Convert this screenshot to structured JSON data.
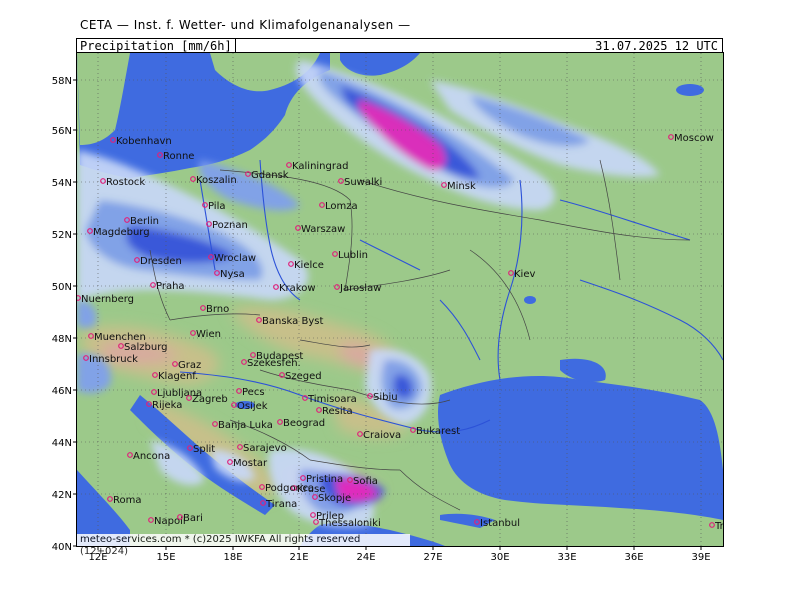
{
  "header": {
    "title": "CETA — Inst. f. Wetter- und Klimafolgenanalysen —",
    "parameter": "Precipitation [mm/6h]",
    "valid_time": "31.07.2025 12 UTC"
  },
  "footer": {
    "copyright": "meteo-services.com * (c)2025 IWKFA  All rights reserved (12+024)"
  },
  "axes": {
    "lat_labels": [
      "58N",
      "56N",
      "54N",
      "52N",
      "50N",
      "48N",
      "46N",
      "44N",
      "42N",
      "40N"
    ],
    "lon_labels": [
      "12E",
      "15E",
      "18E",
      "21E",
      "24E",
      "27E",
      "30E",
      "33E",
      "36E",
      "39E"
    ]
  },
  "colors": {
    "land": "#9cc98a",
    "land_high": "#c7c08a",
    "mountain": "#d9a8a0",
    "sea": "#3f6be0",
    "precip_light": "#c8d8f8",
    "precip_mid": "#7f9fef",
    "precip_heavy": "#3050e0",
    "precip_extreme": "#e020c0",
    "city_marker": "#e0207a"
  },
  "cities": [
    {
      "name": "Kobenhavn"
    },
    {
      "name": "Ronne"
    },
    {
      "name": "Rostock"
    },
    {
      "name": "Koszalin"
    },
    {
      "name": "Gdansk"
    },
    {
      "name": "Kaliningrad"
    },
    {
      "name": "Suwalki"
    },
    {
      "name": "Minsk"
    },
    {
      "name": "Moscow"
    },
    {
      "name": "Pila"
    },
    {
      "name": "Lomza"
    },
    {
      "name": "Berlin"
    },
    {
      "name": "Magdeburg"
    },
    {
      "name": "Poznan"
    },
    {
      "name": "Warszaw"
    },
    {
      "name": "Lublin"
    },
    {
      "name": "Dresden"
    },
    {
      "name": "Wroclaw"
    },
    {
      "name": "Kielce"
    },
    {
      "name": "Nysa"
    },
    {
      "name": "Praha"
    },
    {
      "name": "Krakow"
    },
    {
      "name": "Jaroslaw"
    },
    {
      "name": "Kiev"
    },
    {
      "name": "Nuernberg"
    },
    {
      "name": "Brno"
    },
    {
      "name": "Banska Byst"
    },
    {
      "name": "Muenchen"
    },
    {
      "name": "Salzburg"
    },
    {
      "name": "Wien"
    },
    {
      "name": "Budapest"
    },
    {
      "name": "Szekesfeh."
    },
    {
      "name": "Innsbruck"
    },
    {
      "name": "Graz"
    },
    {
      "name": "Klagenf."
    },
    {
      "name": "Szeged"
    },
    {
      "name": "Ljubljana"
    },
    {
      "name": "Pecs"
    },
    {
      "name": "Zagreb"
    },
    {
      "name": "Rijeka"
    },
    {
      "name": "Osijek"
    },
    {
      "name": "Timisoara"
    },
    {
      "name": "Sibiu"
    },
    {
      "name": "Resita"
    },
    {
      "name": "Banja Luka"
    },
    {
      "name": "Beograd"
    },
    {
      "name": "Bukarest"
    },
    {
      "name": "Craiova"
    },
    {
      "name": "Ancona"
    },
    {
      "name": "Split"
    },
    {
      "name": "Sarajevo"
    },
    {
      "name": "Mostar"
    },
    {
      "name": "Pristina"
    },
    {
      "name": "Sofia"
    },
    {
      "name": "Kruse"
    },
    {
      "name": "Podgorica"
    },
    {
      "name": "Skopje"
    },
    {
      "name": "Tirana"
    },
    {
      "name": "Prilep"
    },
    {
      "name": "Roma"
    },
    {
      "name": "Napoli"
    },
    {
      "name": "Bari"
    },
    {
      "name": "Thessaloniki"
    },
    {
      "name": "Istanbul"
    },
    {
      "name": "Trabzon"
    }
  ]
}
